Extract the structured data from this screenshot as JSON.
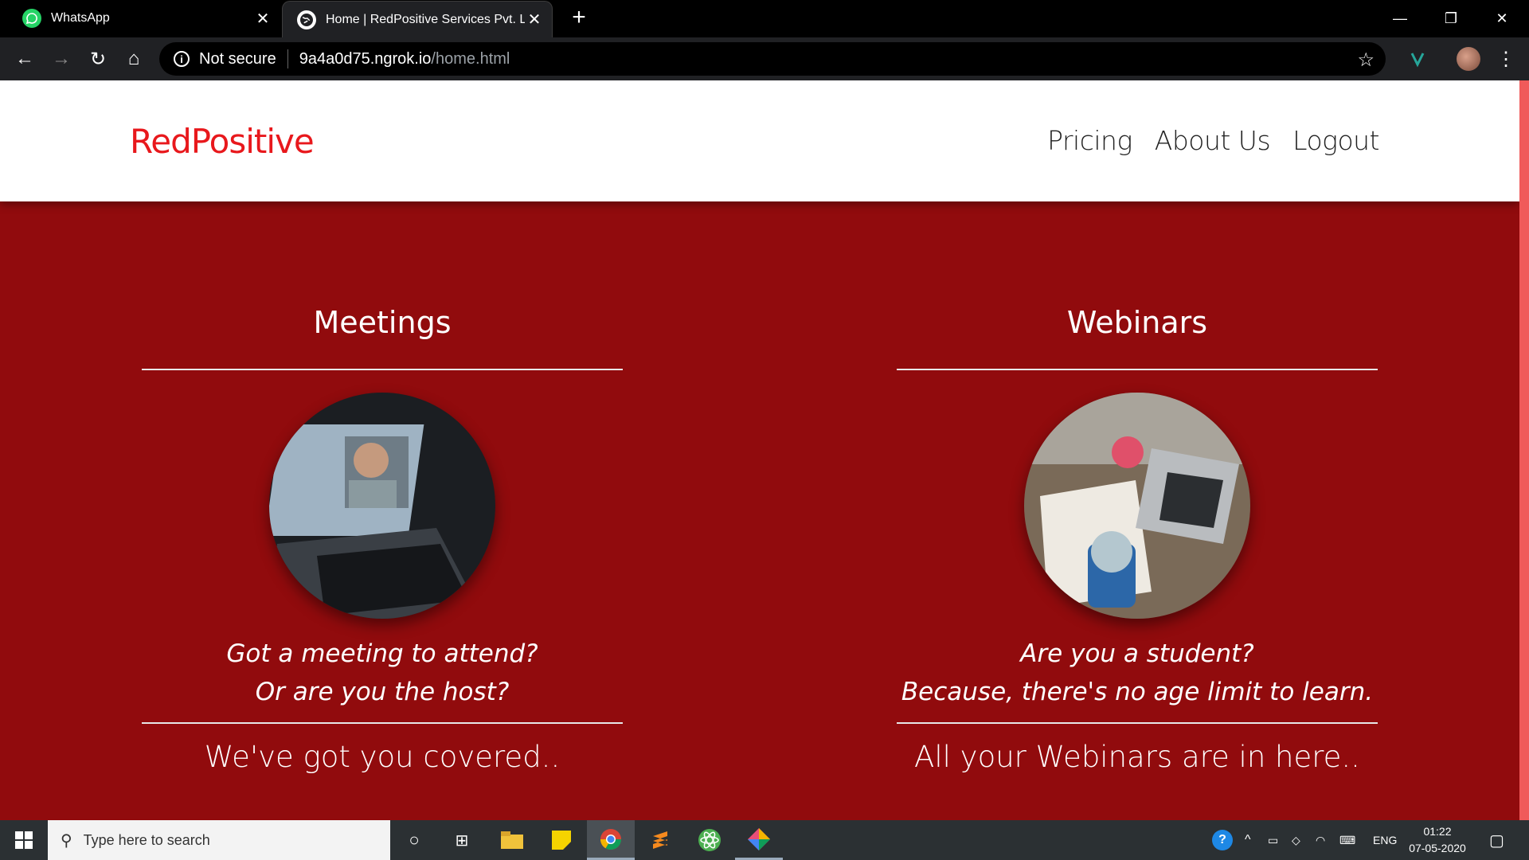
{
  "browser": {
    "tabs": [
      {
        "title": "WhatsApp"
      },
      {
        "title": "Home | RedPositive Services Pvt. Ltd"
      }
    ],
    "new_tab": "+",
    "security": "Not secure",
    "url_host": "9a4a0d75.ngrok.io",
    "url_path": "/home.html"
  },
  "site": {
    "brand": "RedPositive",
    "nav": {
      "pricing": "Pricing",
      "about": "About Us",
      "logout": "Logout"
    },
    "features": [
      {
        "title": "Meetings",
        "line1": "Got a meeting to attend?",
        "line2": "Or are you the host?",
        "tagline": "We've got you covered.."
      },
      {
        "title": "Webinars",
        "line1": "Are you a student?",
        "line2": "Because, there's no age limit to learn.",
        "tagline": "All your Webinars are in here.."
      }
    ]
  },
  "taskbar": {
    "search_placeholder": "Type here to search",
    "language": "ENG",
    "time": "01:22",
    "date": "07-05-2020"
  },
  "colors": {
    "brand": "#e8181c",
    "hero_bg": "#910b0d"
  }
}
